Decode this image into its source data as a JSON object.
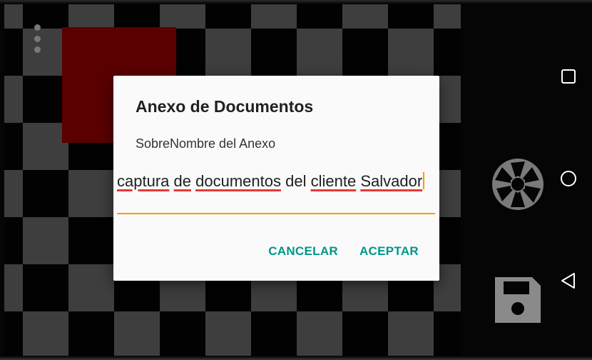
{
  "dialog": {
    "title": "Anexo de Documentos",
    "message": "SobreNombre del Anexo",
    "input": {
      "words": [
        {
          "text": "captura",
          "misspelled": true
        },
        {
          "text": "de",
          "misspelled": true
        },
        {
          "text": "documentos",
          "misspelled": true
        },
        {
          "text": "del",
          "misspelled": false
        },
        {
          "text": "cliente",
          "misspelled": true
        },
        {
          "text": "Salvador",
          "misspelled": true
        }
      ]
    },
    "cancel_label": "CANCELAR",
    "accept_label": "ACEPTAR"
  },
  "camera": {
    "menu_icon": "overflow-menu-icon",
    "shutter_icon": "camera-shutter-icon",
    "save_icon": "floppy-disk-icon"
  },
  "nav": {
    "recents_icon": "square-icon",
    "home_icon": "circle-icon",
    "back_icon": "triangle-back-icon"
  },
  "colors": {
    "accent": "#009688",
    "input_underline": "#ff9800",
    "spellcheck": "#e53935",
    "red_block": "#5a0000"
  }
}
